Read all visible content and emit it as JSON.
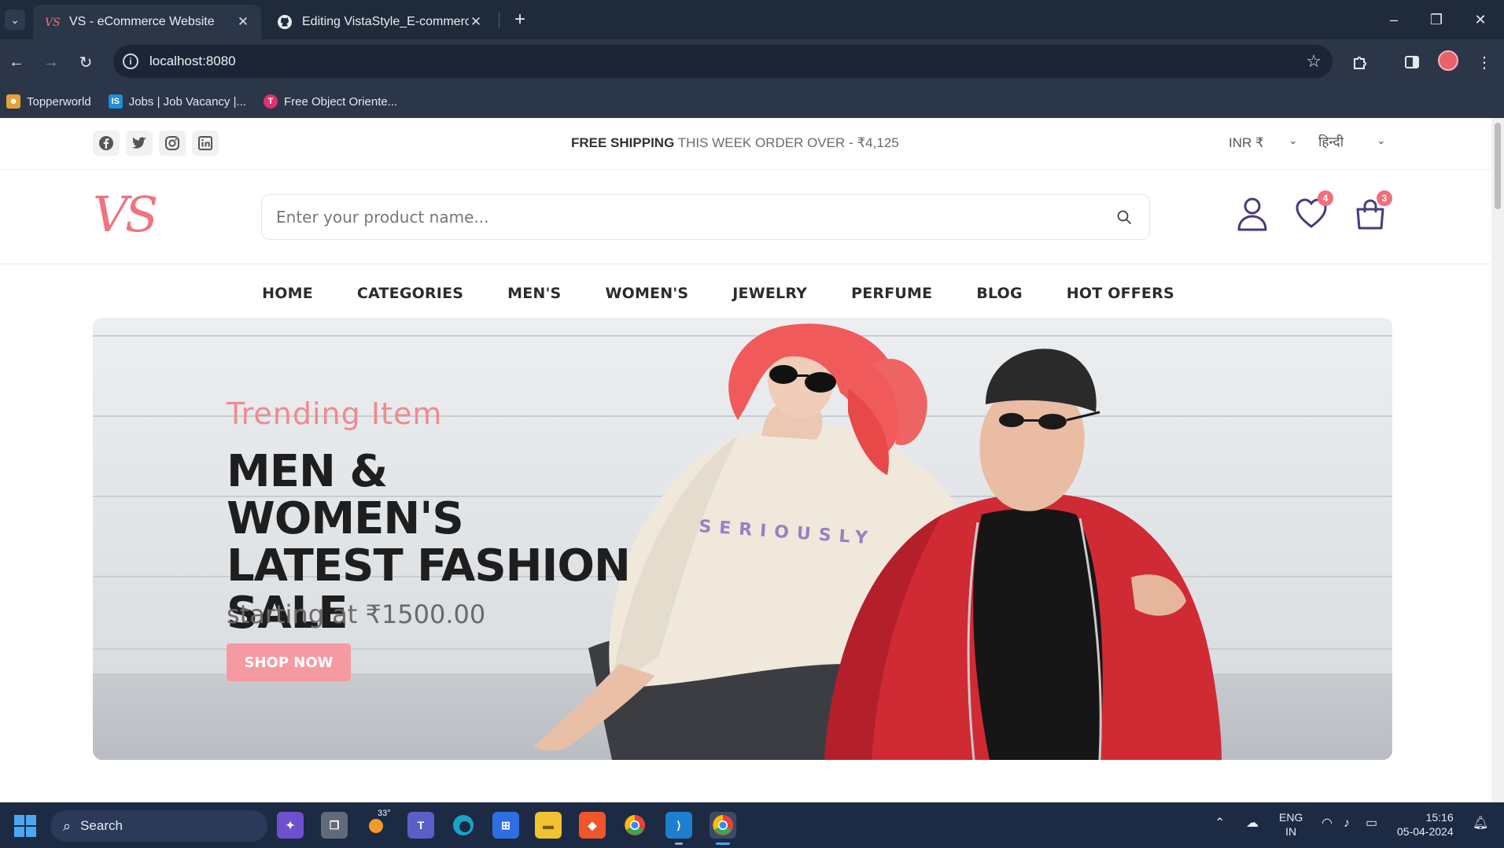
{
  "browser": {
    "tabs": [
      {
        "title": "VS - eCommerce Website",
        "active": true
      },
      {
        "title": "Editing VistaStyle_E-commerce-",
        "active": false
      }
    ],
    "url": "localhost:8080",
    "bookmarks": [
      "Topperworld",
      "Jobs | Job Vacancy |...",
      "Free Object Oriente..."
    ]
  },
  "topbar": {
    "shipping_bold": "FREE SHIPPING",
    "shipping_rest": "THIS WEEK ORDER OVER - ₹4,125",
    "currency": "INR ₹",
    "language": "हिन्दी"
  },
  "header": {
    "logo_text": "VS",
    "search_placeholder": "Enter your product name...",
    "wishlist_count": "4",
    "cart_count": "3"
  },
  "nav": {
    "items": [
      "HOME",
      "CATEGORIES",
      "MEN'S",
      "WOMEN'S",
      "JEWELRY",
      "PERFUME",
      "BLOG",
      "HOT OFFERS"
    ]
  },
  "hero": {
    "subtitle": "Trending Item",
    "title": "MEN & WOMEN'S LATEST FASHION SALE",
    "price_text": "starting at ₹1500.00",
    "cta": "SHOP NOW",
    "sweater_text": "SERIOUSLY"
  },
  "taskbar": {
    "search_label": "Search",
    "weather": "33°",
    "lang_top": "ENG",
    "lang_bottom": "IN",
    "time": "15:16",
    "date": "05-04-2024"
  },
  "colors": {
    "accent_pink": "#f59aa1",
    "badge": "#f0707a",
    "chrome_dark": "#1f2a3a",
    "icon_purple": "#4b3a7a"
  }
}
